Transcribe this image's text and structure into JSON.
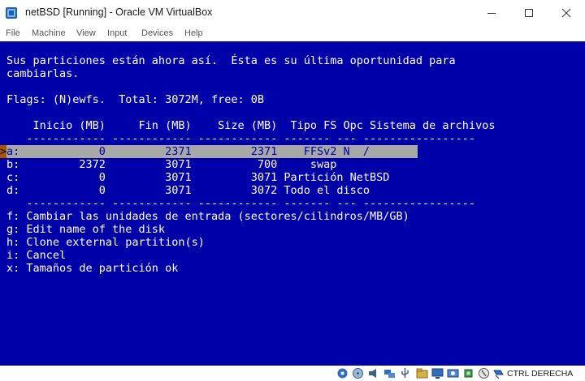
{
  "window": {
    "title": "netBSD [Running] - Oracle VM VirtualBox",
    "minimize_glyph": "—",
    "maximize_glyph": "☐",
    "close_glyph": "✕"
  },
  "menu": [
    "File",
    "Machine",
    "View",
    "Input",
    "Devices",
    "Help"
  ],
  "terminal": {
    "intro_line1": "Sus particiones están ahora así.  Ésta es su última oportunidad para",
    "intro_line2": "cambiarlas.",
    "flags_line": "Flags: (N)ewfs.  Total: 3072M, free: 0B",
    "header": "    Inicio (MB)     Fin (MB)    Size (MB)  Tipo FS Opc Sistema de archivos",
    "separator": "   ------------ ------------ ------------ ------- --- -----------------",
    "rows": [
      {
        "text": "a:            0         2371         2371    FFSv2 N  /"
      },
      {
        "text": "b:         2372         3071          700     swap"
      },
      {
        "text": "c:            0         3071         3071 Partición NetBSD"
      },
      {
        "text": "d:            0         3071         3072 Todo el disco"
      }
    ],
    "cursor_glyph": ">",
    "options": [
      "f: Cambiar las unidades de entrada (sectores/cilindros/MB/GB)",
      "g: Edit name of the disk",
      "h: Clone external partition(s)",
      "i: Cancel",
      "x: Tamaños de partición ok"
    ],
    "colors": {
      "background": "#0000a8",
      "text": "#ffffff",
      "highlight": "#a8a8a8",
      "cursor": "#a85400"
    }
  },
  "statusbar": {
    "icons": [
      "hard-disk-icon",
      "optical-drive-icon",
      "audio-icon",
      "network-icon",
      "usb-icon",
      "shared-folders-icon",
      "display-icon",
      "video-capture-icon",
      "cpu-icon",
      "mouse-integration-icon",
      "keyboard-icon"
    ],
    "host_key": "CTRL DERECHA"
  }
}
